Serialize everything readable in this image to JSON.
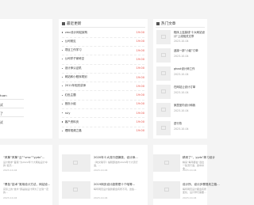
{
  "left_panel": {
    "items": [
      "tuan",
      "试",
      "了",
      "试"
    ]
  },
  "recent": {
    "title": "最近更新",
    "items": [
      {
        "label": "vmc设计网站架构",
        "time": "19:00"
      },
      {
        "label": "公司常见",
        "time": "19:00"
      },
      {
        "label": "项目工作学习",
        "time": "19:00"
      },
      {
        "label": "公司学子家练空",
        "time": "19:00"
      },
      {
        "label": "设计师认证机",
        "time": "19:00"
      },
      {
        "label": "网站和小程序规划",
        "time": "19:00"
      },
      {
        "label": "2011年相关讲师",
        "time": "19:00"
      },
      {
        "label": "红色主题",
        "time": "19:00"
      },
      {
        "label": "首页小组",
        "time": "19:00"
      },
      {
        "label": "ruly",
        "time": "19:00"
      },
      {
        "label": "客户资料页",
        "time": "19:00"
      },
      {
        "label": "理财视频之路",
        "time": "19:00"
      }
    ]
  },
  "hot": {
    "title": "热门文章",
    "items": [
      {
        "title": "程序上连接线\"十大网站设计\"上线相关文章",
        "date": "2023-10-04"
      },
      {
        "title": "迷接一部“小起”订单",
        "date": "2023-10-04"
      },
      {
        "title": "ghost设计师工作",
        "date": "2023-10-04"
      },
      {
        "title": "在网站让设计订单",
        "date": "2023-10-04"
      },
      {
        "title": "家居室内设计和我",
        "date": "2023-10-04"
      },
      {
        "title": "进行热",
        "date": "2023-10-04"
      }
    ]
  },
  "bottom": {
    "col1": [
      {
        "title": "“风筝”风筝“云”“vmc”“yydx”...",
        "desc": "设计教学“首席”为2022年十大网站设计中的“最高...",
        "date": "2023-10-04"
      },
      {
        "title": "“黑色”技术”常用设计方法，网站设...",
        "desc": "实际上的“技术”即是指设计师为了达到一定的...",
        "date": "2023-10-04"
      }
    ],
    "col2": [
      {
        "title": "2020年十大流行语摘录，设计师...",
        "desc": "《咬文嚼字》编辑部发布2020年十大流行语，…",
        "date": "2023-10-04"
      },
      {
        "title": "2019网页设计趋势是十个啥等…",
        "desc": "每年网页设计趋势都会有所不同，这些...",
        "date": "2023-10-04"
      }
    ],
    "col3": [
      {
        "title": "精来了“，yyds”练习设计",
        "desc": "精来“每年都会”选出一些流行语，其中并非...",
        "date": "2023-10-04"
      },
      {
        "title": "设计所，设计步骤规划之路…",
        "desc": "每年网页设计都会有所变化，设计师们需要…",
        "date": "2023-10-04"
      }
    ]
  }
}
